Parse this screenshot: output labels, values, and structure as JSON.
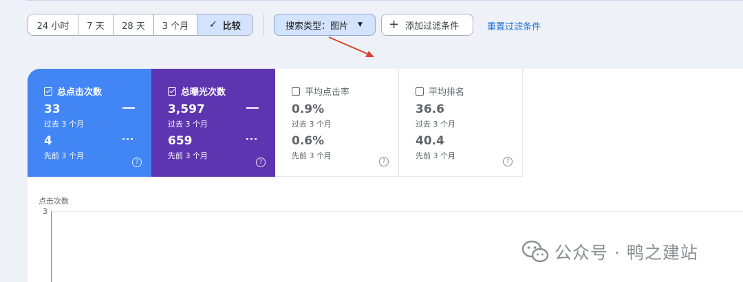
{
  "toolbar": {
    "time_ranges": [
      "24 小时",
      "7 天",
      "28 天",
      "3 个月"
    ],
    "compare_label": "比较",
    "filter_label": "搜索类型：图片",
    "add_filter_label": "添加过滤条件",
    "reset_label": "重置过滤条件"
  },
  "metrics": [
    {
      "label": "总点击次数",
      "checked": true,
      "value": "33",
      "period": "过去 3 个月",
      "prev_value": "4",
      "prev_period": "先前 3 个月",
      "color": "#4285f4"
    },
    {
      "label": "总曝光次数",
      "checked": true,
      "value": "3,597",
      "period": "过去 3 个月",
      "prev_value": "659",
      "prev_period": "先前 3 个月",
      "color": "#5e35b1"
    },
    {
      "label": "平均点击率",
      "checked": false,
      "value": "0.9%",
      "period": "过去 3 个月",
      "prev_value": "0.6%",
      "prev_period": "先前 3 个月"
    },
    {
      "label": "平均排名",
      "checked": false,
      "value": "36.6",
      "period": "过去 3 个月",
      "prev_value": "40.4",
      "prev_period": "先前 3 个月"
    }
  ],
  "chart": {
    "y_title": "点击次数",
    "y_tick": "3"
  },
  "watermark": {
    "text": "公众号 · 鸭之建站"
  },
  "icons": {
    "help": "help-circle-icon",
    "check": "check-icon",
    "plus": "plus-icon",
    "dropdown": "dropdown-caret-icon",
    "wechat": "wechat-icon"
  }
}
